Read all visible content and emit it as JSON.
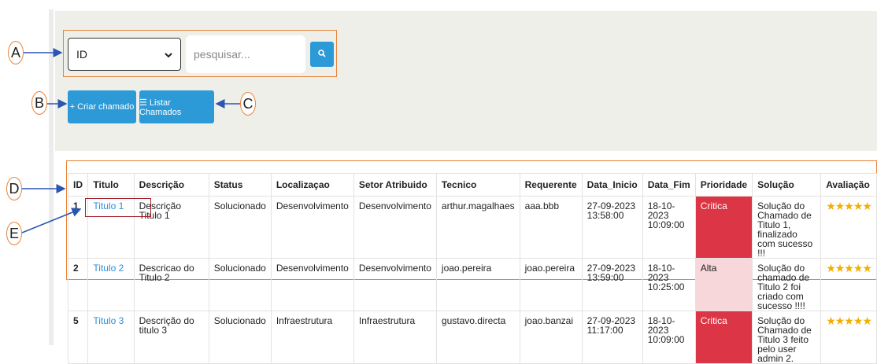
{
  "search": {
    "select_value": "ID",
    "placeholder": "pesquisar..."
  },
  "buttons": {
    "create": "+ Criar chamado",
    "list": "☰ Listar Chamados"
  },
  "callouts": {
    "a": "A",
    "b": "B",
    "c": "C",
    "d": "D",
    "e": "E"
  },
  "table": {
    "headers": [
      "ID",
      "Titulo",
      "Descrição",
      "Status",
      "Localizaçao",
      "Setor Atribuido",
      "Tecnico",
      "Requerente",
      "Data_Inicio",
      "Data_Fim",
      "Prioridade",
      "Solução",
      "Avaliação"
    ],
    "rows": [
      {
        "id": "1",
        "titulo": "Titulo 1",
        "descricao": "Descrição Titulo 1",
        "status": "Solucionado",
        "local": "Desenvolvimento",
        "setor": "Desenvolvimento",
        "tecnico": "arthur.magalhaes",
        "requerente": "aaa.bbb",
        "inicio": "27-09-2023 13:58:00",
        "fim": "18-10-2023 10:09:00",
        "prioridade": "Critica",
        "solucao": "Solução do Chamado de Titulo 1, finalizado com sucesso !!!",
        "avaliacao": "★★★★★"
      },
      {
        "id": "2",
        "titulo": "Titulo 2",
        "descricao": "Descricao do Titulo 2",
        "status": "Solucionado",
        "local": "Desenvolvimento",
        "setor": "Desenvolvimento",
        "tecnico": "joao.pereira",
        "requerente": "joao.pereira",
        "inicio": "27-09-2023 13:59:00",
        "fim": "18-10-2023 10:25:00",
        "prioridade": "Alta",
        "solucao": "Solução do chamado de Titulo 2 foi criado com sucesso !!!!",
        "avaliacao": "★★★★★"
      },
      {
        "id": "5",
        "titulo": "Titulo 3",
        "descricao": "Descrição do titulo 3",
        "status": "Solucionado",
        "local": "Infraestrutura",
        "setor": "Infraestrutura",
        "tecnico": "gustavo.directa",
        "requerente": "joao.banzai",
        "inicio": "27-09-2023 11:17:00",
        "fim": "18-10-2023 10:09:00",
        "prioridade": "Critica",
        "solucao": "Solução do Chamado de Titulo 3 feito pelo user admin 2.",
        "avaliacao": "★★★★★"
      }
    ]
  },
  "colors": {
    "accent": "#2c9ad6",
    "critical": "#dc3545",
    "high": "#f8d7da",
    "annotation": "#e8833a",
    "stars": "#f0b000"
  }
}
